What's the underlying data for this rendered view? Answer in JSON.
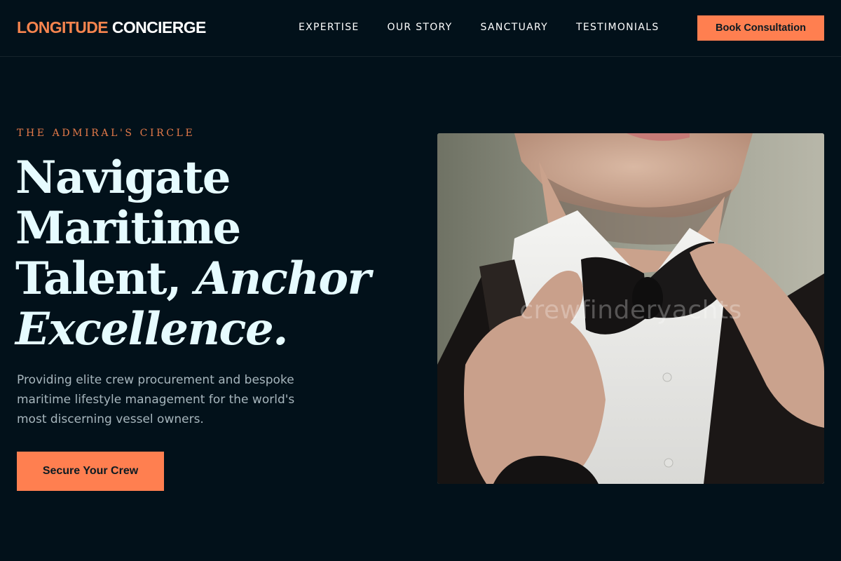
{
  "brand": {
    "part1": "LONGITUDE",
    "part2": "CONCIERGE"
  },
  "nav": {
    "links": [
      "EXPERTISE",
      "OUR STORY",
      "SANCTUARY",
      "TESTIMONIALS"
    ],
    "cta": "Book Consultation"
  },
  "hero": {
    "eyebrow": "THE ADMIRAL'S CIRCLE",
    "headline": {
      "line1": "Navigate",
      "line2": "Maritime",
      "line3_plain": "Talent,",
      "line3_italic": "Anchor",
      "line4_italic": "Excellence."
    },
    "lede": "Providing elite crew procurement and bespoke maritime lifestyle management for the world's most discerning vessel owners.",
    "cta": "Secure Your Crew",
    "image": {
      "watermark": "crewfinderyachts"
    }
  },
  "colors": {
    "accent": "#ff7f50",
    "background": "#02111a",
    "eyebrow": "#e47a49"
  }
}
